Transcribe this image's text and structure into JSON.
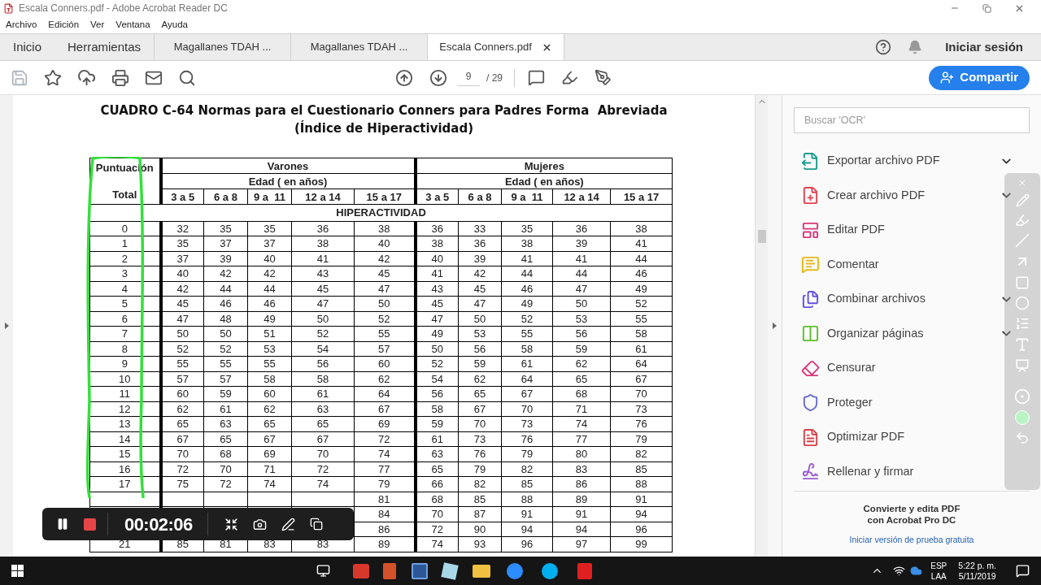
{
  "window": {
    "title": "Escala Conners.pdf - Adobe Acrobat Reader DC"
  },
  "menu": [
    "Archivo",
    "Edición",
    "Ver",
    "Ventana",
    "Ayuda"
  ],
  "tabs": [
    {
      "label": "Inicio",
      "kind": "nav",
      "selected": false
    },
    {
      "label": "Herramientas",
      "kind": "nav",
      "selected": false
    },
    {
      "label": "Magallanes TDAH ...",
      "kind": "document",
      "selected": false
    },
    {
      "label": "Magallanes TDAH ...",
      "kind": "document",
      "selected": false
    },
    {
      "label": "Escala Conners.pdf",
      "kind": "document",
      "selected": true
    }
  ],
  "account": {
    "sign_in": "Iniciar sesión"
  },
  "toolbar": {
    "page_current": "9",
    "page_total": "/ 29",
    "share_button": "Compartir"
  },
  "document": {
    "title_lines": [
      "CUADRO C-64 Normas para el Cuestionario Conners para Padres Forma  Abreviada",
      "(Índice de Hiperactividad)"
    ],
    "table": {
      "total_header_top": "Puntuación",
      "total_header_bottom": "Total",
      "groups": [
        {
          "name": "Varones",
          "age_header": "Edad ( en años)",
          "ages": [
            "3 a 5",
            "6 a 8",
            "9 a  11",
            "12 a 14",
            "15 a 17"
          ]
        },
        {
          "name": "Mujeres",
          "age_header": "Edad ( en años)",
          "ages": [
            "3 a 5",
            "6 a 8",
            "9 a  11",
            "12 a 14",
            "15 a 17"
          ]
        }
      ],
      "section": "HIPERACTIVIDAD",
      "rows": [
        {
          "total": "0",
          "values": [
            "32",
            "35",
            "35",
            "36",
            "38",
            "36",
            "33",
            "35",
            "36",
            "38"
          ]
        },
        {
          "total": "1",
          "values": [
            "35",
            "37",
            "37",
            "38",
            "40",
            "38",
            "36",
            "38",
            "39",
            "41"
          ]
        },
        {
          "total": "2",
          "values": [
            "37",
            "39",
            "40",
            "41",
            "42",
            "40",
            "39",
            "41",
            "41",
            "44"
          ]
        },
        {
          "total": "3",
          "values": [
            "40",
            "42",
            "42",
            "43",
            "45",
            "41",
            "42",
            "44",
            "44",
            "46"
          ]
        },
        {
          "total": "4",
          "values": [
            "42",
            "44",
            "44",
            "45",
            "47",
            "43",
            "45",
            "46",
            "47",
            "49"
          ]
        },
        {
          "total": "5",
          "values": [
            "45",
            "46",
            "46",
            "47",
            "50",
            "45",
            "47",
            "49",
            "50",
            "52"
          ]
        },
        {
          "total": "6",
          "values": [
            "47",
            "48",
            "49",
            "50",
            "52",
            "47",
            "50",
            "52",
            "53",
            "55"
          ]
        },
        {
          "total": "7",
          "values": [
            "50",
            "50",
            "51",
            "52",
            "55",
            "49",
            "53",
            "55",
            "56",
            "58"
          ]
        },
        {
          "total": "8",
          "values": [
            "52",
            "52",
            "53",
            "54",
            "57",
            "50",
            "56",
            "58",
            "59",
            "61"
          ]
        },
        {
          "total": "9",
          "values": [
            "55",
            "55",
            "55",
            "56",
            "60",
            "52",
            "59",
            "61",
            "62",
            "64"
          ]
        },
        {
          "total": "10",
          "values": [
            "57",
            "57",
            "58",
            "58",
            "62",
            "54",
            "62",
            "64",
            "65",
            "67"
          ]
        },
        {
          "total": "11",
          "values": [
            "60",
            "59",
            "60",
            "61",
            "64",
            "56",
            "65",
            "67",
            "68",
            "70"
          ]
        },
        {
          "total": "12",
          "values": [
            "62",
            "61",
            "62",
            "63",
            "67",
            "58",
            "67",
            "70",
            "71",
            "73"
          ]
        },
        {
          "total": "13",
          "values": [
            "65",
            "63",
            "65",
            "65",
            "69",
            "59",
            "70",
            "73",
            "74",
            "76"
          ]
        },
        {
          "total": "14",
          "values": [
            "67",
            "65",
            "67",
            "67",
            "72",
            "61",
            "73",
            "76",
            "77",
            "79"
          ]
        },
        {
          "total": "15",
          "values": [
            "70",
            "68",
            "69",
            "70",
            "74",
            "63",
            "76",
            "79",
            "80",
            "82"
          ]
        },
        {
          "total": "16",
          "values": [
            "72",
            "70",
            "71",
            "72",
            "77",
            "65",
            "79",
            "82",
            "83",
            "85"
          ]
        },
        {
          "total": "17",
          "values": [
            "75",
            "72",
            "74",
            "74",
            "79",
            "66",
            "82",
            "85",
            "86",
            "88"
          ]
        },
        {
          "kind": "covered",
          "values": [
            "81",
            "68",
            "85",
            "88",
            "89",
            "91"
          ]
        },
        {
          "kind": "covered",
          "values": [
            "84",
            "70",
            "87",
            "91",
            "91",
            "94"
          ]
        },
        {
          "kind": "covered",
          "values": [
            "86",
            "72",
            "90",
            "94",
            "94",
            "96"
          ]
        },
        {
          "total": "21",
          "values": [
            "85",
            "81",
            "83",
            "83",
            "89",
            "74",
            "93",
            "96",
            "97",
            "99"
          ]
        }
      ]
    }
  },
  "tools_panel": {
    "search_placeholder": "Buscar 'OCR'",
    "items": [
      {
        "label": "Exportar archivo PDF",
        "color": "#1a9c8c",
        "expandable": true
      },
      {
        "label": "Crear archivo PDF",
        "color": "#e0454f",
        "expandable": true
      },
      {
        "label": "Editar PDF",
        "color": "#d8377a",
        "expandable": false
      },
      {
        "label": "Comentar",
        "color": "#e6b81e",
        "expandable": false
      },
      {
        "label": "Combinar archivos",
        "color": "#6252e0",
        "expandable": true
      },
      {
        "label": "Organizar páginas",
        "color": "#5fbf2c",
        "expandable": true
      },
      {
        "label": "Censurar",
        "color": "#d8377a",
        "expandable": false
      },
      {
        "label": "Proteger",
        "color": "#6b6bd6",
        "expandable": false
      },
      {
        "label": "Optimizar PDF",
        "color": "#d9414a",
        "expandable": false
      },
      {
        "label": "Rellenar y firmar",
        "color": "#9b5bd6",
        "expandable": false
      }
    ],
    "promo_lines": [
      "Convierte y edita PDF",
      "con Acrobat Pro DC"
    ],
    "promo_link": "Iniciar versión de prueba gratuita"
  },
  "recorder": {
    "time": "00:02:06"
  },
  "taskbar": {
    "language": "ESP",
    "layout": "LAA",
    "time": "5:22 p. m.",
    "date": "5/11/2019"
  }
}
